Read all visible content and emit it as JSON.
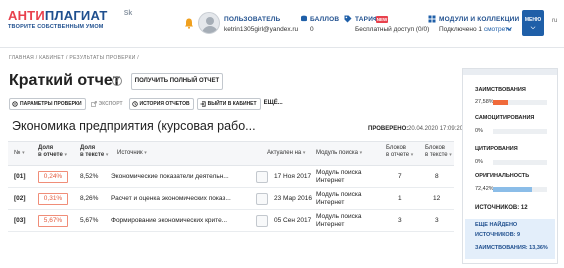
{
  "header": {
    "logo_main_part1": "АНТИ",
    "logo_main_part2": "ПЛАГИАТ",
    "logo_sub": "ТВОРИТЕ СОБСТВЕННЫМ УМОМ",
    "sk_badge": "Sk",
    "user_label": "ПОЛЬЗОВАТЕЛЬ",
    "user_email": "ketrin1305girl@yandex.ru",
    "points_label": "БАЛЛОВ",
    "points_value": "0",
    "tariff_label": "ТАРИФ",
    "tariff_badge": "NEW",
    "tariff_value": "Бесплатный доступ (0/0)",
    "modules_label": "МОДУЛИ И КОЛЛЕКЦИИ",
    "modules_value": "Подключено 1",
    "modules_link": "смотреть",
    "menu_label": "МЕНЮ",
    "lang": "ru"
  },
  "breadcrumb": "ГЛАВНАЯ / КАБИНЕТ / РЕЗУЛЬТАТЫ ПРОВЕРКИ /",
  "page": {
    "title": "Краткий отчет",
    "full_report_button": "ПОЛУЧИТЬ ПОЛНЫЙ ОТЧЕТ",
    "actions": {
      "params": "ПАРАМЕТРЫ ПРОВЕРКИ",
      "export": "ЭКСПОРТ",
      "history": "ИСТОРИЯ ОТЧЕТОВ",
      "exit": "ВЫЙТИ В КАБИНЕТ",
      "more": "ЕЩЁ..."
    },
    "doc_title": "Экономика предприятия (курсовая рабо...",
    "checked_label": "ПРОВЕРЕНО:",
    "checked_value": "20.04.2020 17:09:20"
  },
  "table": {
    "headers": {
      "num": "№",
      "share_in_report_1": "Доля",
      "share_in_report_2": "в отчете",
      "share_in_text_1": "Доля",
      "share_in_text_2": "в тексте",
      "source": "Источник",
      "relevant_1": "Актуален на",
      "module_1": "Модуль поиска",
      "blocks_report_1": "Блоков",
      "blocks_report_2": "в отчете",
      "blocks_text_1": "Блоков",
      "blocks_text_2": "в тексте"
    },
    "rows": [
      {
        "idx": "[01]",
        "share_report": "0,24%",
        "share_text": "8,52%",
        "source": "Экономические показатели деятельн...",
        "date": "17 Ноя 2017",
        "module_1": "Модуль поиска",
        "module_2": "Интернет",
        "blocks_report": "7",
        "blocks_text": "8"
      },
      {
        "idx": "[02]",
        "share_report": "0,31%",
        "share_text": "8,26%",
        "source": "Расчет и оценка экономических показ...",
        "date": "23 Мар 2016",
        "module_1": "Модуль поиска",
        "module_2": "Интернет",
        "blocks_report": "1",
        "blocks_text": "12"
      },
      {
        "idx": "[03]",
        "share_report": "5,67%",
        "share_text": "5,67%",
        "source": "Формирование экономических крите...",
        "date": "05 Сен 2017",
        "module_1": "Модуль поиска",
        "module_2": "Интернет",
        "blocks_report": "3",
        "blocks_text": "3"
      }
    ]
  },
  "sidebar": {
    "borrowings_label": "ЗАИМСТВОВАНИЯ",
    "borrowings_value": "27,58%",
    "borrowings_fraction": 0.2758,
    "self_cite_label": "САМОЦИТИРОВАНИЯ",
    "self_cite_value": "0%",
    "cite_label": "ЦИТИРОВАНИЯ",
    "cite_value": "0%",
    "originality_label": "ОРИГИНАЛЬНОСТЬ",
    "originality_value": "72,42%",
    "originality_fraction": 0.7242,
    "sources_label": "ИСТОЧНИКОВ: 12",
    "found_label": "ЕЩЕ НАЙДЕНО",
    "found_sources": "ИСТОЧНИКОВ: 9",
    "found_borrowings": "ЗАИМСТВОВАНИЯ: 13,36%",
    "colors": {
      "borrowings": "#f06a3b",
      "originality": "#8bbde8"
    }
  }
}
